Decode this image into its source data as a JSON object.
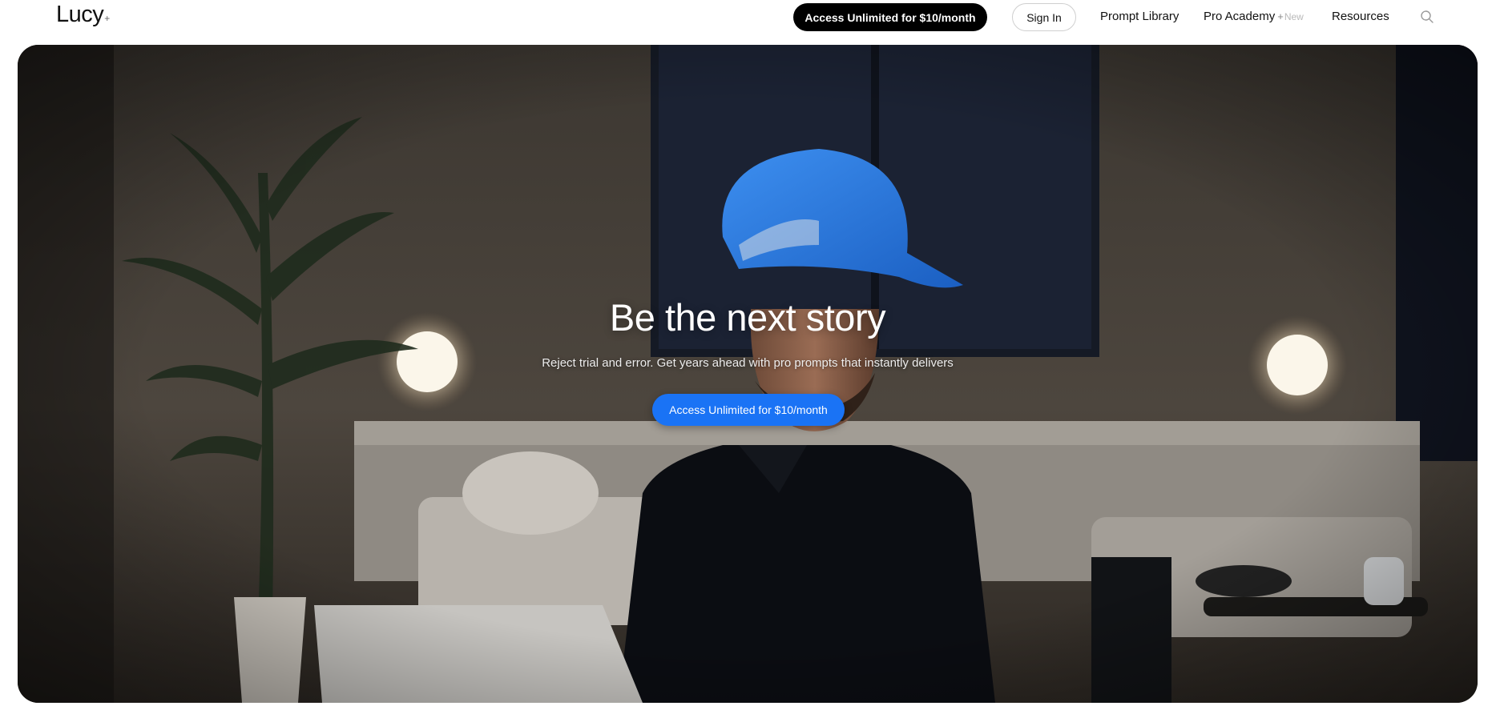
{
  "nav": {
    "logo_text": "Lucy",
    "logo_plus": "+",
    "cta_label": "Access Unlimited for $10/month",
    "sign_in_label": "Sign In",
    "links": [
      {
        "label": "Prompt Library"
      },
      {
        "label": "Pro Academy",
        "plus": "+",
        "badge": "New"
      },
      {
        "label": "Resources"
      }
    ],
    "search_icon": "search-icon"
  },
  "hero": {
    "title": "Be the next story",
    "subtitle": "Reject trial and error. Get years ahead with pro prompts that instantly delivers",
    "cta_label": "Access Unlimited for $10/month",
    "background_image": "man-in-blue-cap-at-laptop-in-dim-living-room"
  },
  "colors": {
    "nav_cta_bg": "#000000",
    "hero_cta_bg": "#1a73f5",
    "hero_cta_text": "#ffffff"
  }
}
